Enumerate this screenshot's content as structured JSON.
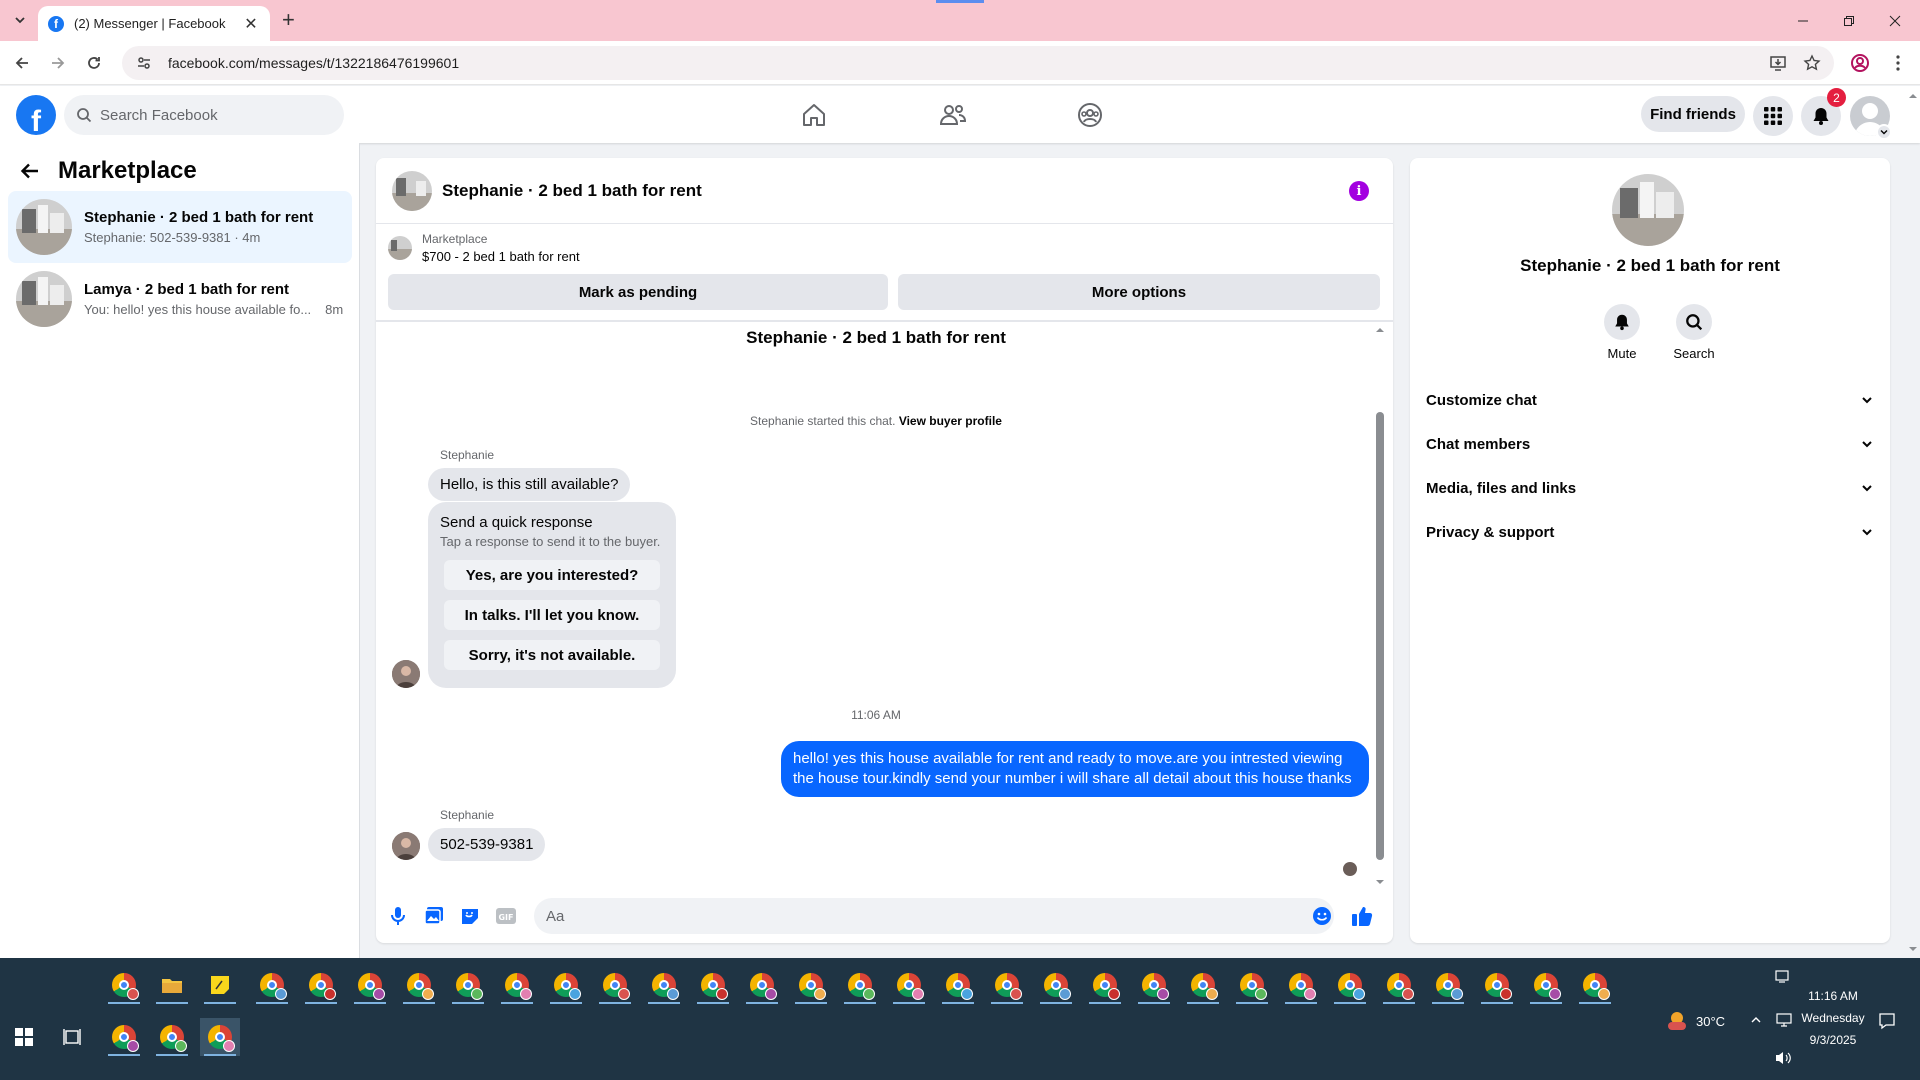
{
  "browser": {
    "tab_title": "(2) Messenger | Facebook",
    "url": "facebook.com/messages/t/1322186476199601"
  },
  "fb": {
    "search_placeholder": "Search Facebook",
    "find_friends": "Find friends",
    "notification_count": "2"
  },
  "left": {
    "title": "Marketplace",
    "conversations": [
      {
        "name": "Stephanie · 2 bed 1 bath for rent",
        "preview": "Stephanie: 502-539-9381 · 4m"
      },
      {
        "name": "Lamya · 2 bed 1 bath for rent",
        "preview": "You: hello! yes this house available fo...",
        "time": "8m"
      }
    ]
  },
  "chat": {
    "title": "Stephanie · 2 bed 1 bath for rent",
    "listing_source": "Marketplace",
    "listing_title": "$700 - 2 bed 1 bath for rent",
    "mark_pending": "Mark as pending",
    "more_options": "More options",
    "conversation_title": "Stephanie · 2 bed 1 bath for rent",
    "started_text": "Stephanie started this chat.",
    "view_profile": "View buyer profile",
    "sender": "Stephanie",
    "msg1": "Hello, is this still available?",
    "quick_title": "Send a quick response",
    "quick_sub": "Tap a response to send it to the buyer.",
    "quick_options": [
      "Yes, are you interested?",
      "In talks. I'll let you know.",
      "Sorry, it's not available."
    ],
    "timestamp": "11:06 AM",
    "outgoing": "hello! yes this house available for rent and ready to move.are you intrested viewing the house tour.kindly send your number i will share all detail about this house thanks",
    "sender2": "Stephanie",
    "msg2": "502-539-9381",
    "composer_placeholder": "Aa"
  },
  "right": {
    "name": "Stephanie · 2 bed 1 bath for rent",
    "mute": "Mute",
    "search": "Search",
    "rows": [
      "Customize chat",
      "Chat members",
      "Media, files and links",
      "Privacy & support"
    ]
  },
  "taskbar": {
    "weather": "30°C",
    "time": "11:16 AM",
    "day": "Wednesday",
    "date": "9/3/2025"
  },
  "colors": {
    "fb_blue": "#1877f2",
    "messenger_blue": "#0866ff",
    "info_purple": "#a300e0",
    "tab_bar": "#f8c6d0",
    "taskbar": "#1f3444"
  }
}
